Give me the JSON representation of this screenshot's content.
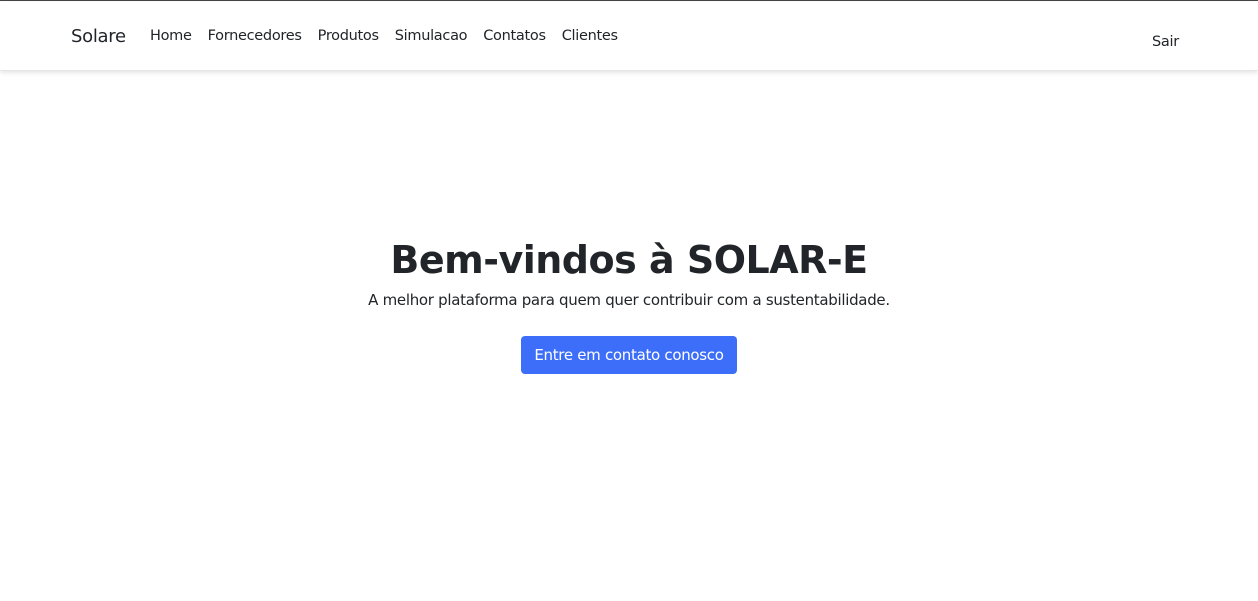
{
  "navbar": {
    "brand": "Solare",
    "items": [
      {
        "label": "Home"
      },
      {
        "label": "Fornecedores"
      },
      {
        "label": "Produtos"
      },
      {
        "label": "Simulacao"
      },
      {
        "label": "Contatos"
      },
      {
        "label": "Clientes"
      }
    ],
    "logout_label": "Sair"
  },
  "hero": {
    "title": "Bem-vindos à SOLAR-E",
    "subtitle": "A melhor plataforma para quem quer contribuir com a sustentabilidade.",
    "cta_label": "Entre em contato conosco"
  },
  "colors": {
    "primary": "#3c6ef9",
    "text": "#212529"
  }
}
